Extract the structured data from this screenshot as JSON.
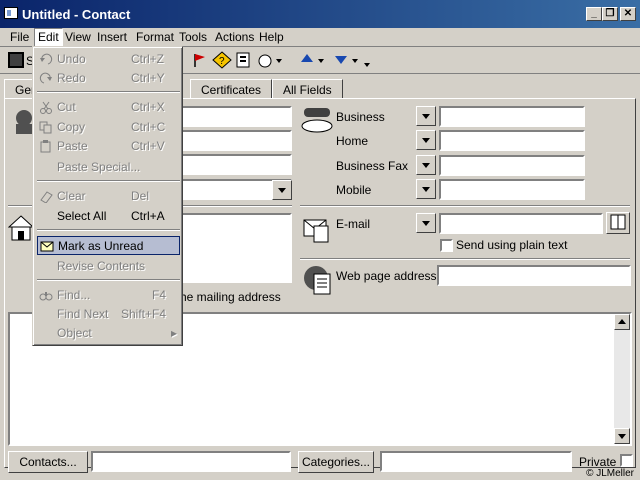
{
  "window": {
    "title": "Untitled - Contact",
    "controls": {
      "minimize": "_",
      "restore": "❐",
      "close": "✕"
    }
  },
  "menubar": {
    "items": [
      "File",
      "Edit",
      "View",
      "Insert",
      "Format",
      "Tools",
      "Actions",
      "Help"
    ],
    "active": "Edit"
  },
  "toolbar": {
    "save_letter": "S",
    "icons": [
      "save-icon",
      "flag-icon",
      "follow-up-icon",
      "new-item-icon",
      "attach-icon",
      "up-arrow-icon",
      "down-arrow-icon"
    ]
  },
  "tabs": [
    "Gen",
    "Certificates",
    "All Fields"
  ],
  "phones": {
    "labels": [
      "Business",
      "Home",
      "Business Fax",
      "Mobile"
    ]
  },
  "email": {
    "label": "E-mail",
    "plain_text_label": "Send using plain text"
  },
  "web": {
    "label": "Web page address:"
  },
  "address": {
    "mailing_text": "he mailing address"
  },
  "footer": {
    "contacts_button": "Contacts...",
    "categories_button": "Categories...",
    "private_label": "Private",
    "copyright": "© JLMeller"
  },
  "edit_menu": {
    "items": [
      {
        "label": "Undo",
        "shortcut": "Ctrl+Z",
        "disabled": true
      },
      {
        "label": "Redo",
        "shortcut": "Ctrl+Y",
        "disabled": true
      },
      {
        "label": "Cut",
        "shortcut": "Ctrl+X",
        "disabled": true
      },
      {
        "label": "Copy",
        "shortcut": "Ctrl+C",
        "disabled": true
      },
      {
        "label": "Paste",
        "shortcut": "Ctrl+V",
        "disabled": true
      },
      {
        "label": "Paste Special...",
        "shortcut": "",
        "disabled": true
      },
      {
        "label": "Clear",
        "shortcut": "Del",
        "disabled": true
      },
      {
        "label": "Select All",
        "shortcut": "Ctrl+A",
        "disabled": false
      },
      {
        "label": "Mark as Unread",
        "shortcut": "",
        "disabled": false,
        "selected": true
      },
      {
        "label": "Revise Contents",
        "shortcut": "",
        "disabled": true
      },
      {
        "label": "Find...",
        "shortcut": "F4",
        "disabled": true
      },
      {
        "label": "Find Next",
        "shortcut": "Shift+F4",
        "disabled": true
      },
      {
        "label": "Object",
        "shortcut": "▸",
        "disabled": true
      }
    ]
  },
  "colors": {
    "titlebar_start": "#0a246a",
    "titlebar_end": "#3a6ea5",
    "chrome": "#d4d0c8",
    "menu_highlight": "#b6bdd2"
  }
}
